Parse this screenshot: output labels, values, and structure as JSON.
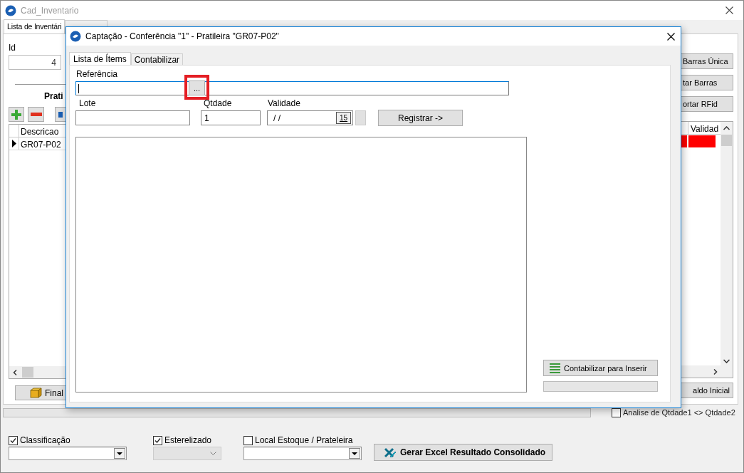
{
  "window": {
    "title": "Cad_Inventario"
  },
  "tabs": [
    {
      "label": "Lista de Inventári",
      "selected": true
    },
    {
      "selected": false
    }
  ],
  "status_progress": {
    "level": 0
  },
  "left": {
    "id_label": "Id",
    "id_value": "4",
    "section_title": "Prati",
    "grid": {
      "columns": [
        "Descricao"
      ],
      "rows": [
        {
          "cells": [
            "GR07-P02"
          ],
          "selected": true
        }
      ]
    },
    "finish_button": "Final"
  },
  "right": {
    "buttons": [
      "Barras Única",
      "tar Barras",
      "ortar RFid"
    ],
    "grid": {
      "columns": [
        "Validad"
      ],
      "rows": [
        {
          "color": "#ff0000"
        }
      ]
    },
    "balance_button": "aldo Inicial"
  },
  "analysis_checkbox": {
    "label": "Analise de Qtdade1 <> Qtdade2",
    "checked": false
  },
  "filters": [
    {
      "label": "Classificação",
      "checked": true,
      "disabled": false
    },
    {
      "label": "Esterelizado",
      "checked": true,
      "disabled": true
    },
    {
      "label": "Local Estoque / Prateleira",
      "checked": false,
      "disabled": false
    }
  ],
  "excel_button": "Gerar Excel Resultado Consolidado",
  "dialog": {
    "title": "Captação - Conferência \"1\" - Pratileira \"GR07-P02\"",
    "tabs": [
      {
        "label": "Lista de Ítems",
        "selected": true
      },
      {
        "label": "Contabilizar",
        "selected": false
      }
    ],
    "reference_label": "Referência",
    "browse_button": "...",
    "browse_highlighted": true,
    "lot_label": "Lote",
    "qty_label": "Qtdade",
    "qty_value": "1",
    "validity_label": "Validade",
    "validity_value": "/ /",
    "calendar_button": "15",
    "register_button": "Registrar ->",
    "post_button": "Contabilizar para Inserir",
    "progress": {
      "level": 0
    }
  }
}
